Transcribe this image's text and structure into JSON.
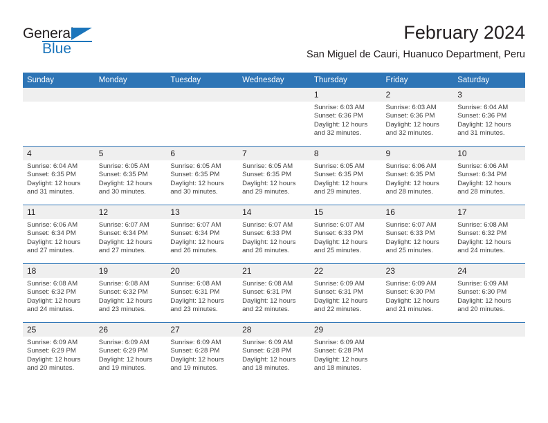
{
  "brand": {
    "name_part1": "General",
    "name_part2": "Blue",
    "triangle_icon": "triangle-icon",
    "colors": {
      "blue": "#1b75bb",
      "black": "#231f20"
    }
  },
  "header": {
    "title": "February 2024",
    "subtitle": "San Miguel de Cauri, Huanuco Department, Peru"
  },
  "theme": {
    "header_blue": "#2e75b6",
    "daynum_band": "#efefef",
    "text": "#404040"
  },
  "weekdays": [
    "Sunday",
    "Monday",
    "Tuesday",
    "Wednesday",
    "Thursday",
    "Friday",
    "Saturday"
  ],
  "weeks": [
    [
      {
        "day": "",
        "empty": true,
        "sunrise": "",
        "sunset": "",
        "daylight1": "",
        "daylight2": ""
      },
      {
        "day": "",
        "empty": true,
        "sunrise": "",
        "sunset": "",
        "daylight1": "",
        "daylight2": ""
      },
      {
        "day": "",
        "empty": true,
        "sunrise": "",
        "sunset": "",
        "daylight1": "",
        "daylight2": ""
      },
      {
        "day": "",
        "empty": true,
        "sunrise": "",
        "sunset": "",
        "daylight1": "",
        "daylight2": ""
      },
      {
        "day": "1",
        "empty": false,
        "sunrise": "Sunrise: 6:03 AM",
        "sunset": "Sunset: 6:36 PM",
        "daylight1": "Daylight: 12 hours",
        "daylight2": "and 32 minutes."
      },
      {
        "day": "2",
        "empty": false,
        "sunrise": "Sunrise: 6:03 AM",
        "sunset": "Sunset: 6:36 PM",
        "daylight1": "Daylight: 12 hours",
        "daylight2": "and 32 minutes."
      },
      {
        "day": "3",
        "empty": false,
        "sunrise": "Sunrise: 6:04 AM",
        "sunset": "Sunset: 6:36 PM",
        "daylight1": "Daylight: 12 hours",
        "daylight2": "and 31 minutes."
      }
    ],
    [
      {
        "day": "4",
        "empty": false,
        "sunrise": "Sunrise: 6:04 AM",
        "sunset": "Sunset: 6:35 PM",
        "daylight1": "Daylight: 12 hours",
        "daylight2": "and 31 minutes."
      },
      {
        "day": "5",
        "empty": false,
        "sunrise": "Sunrise: 6:05 AM",
        "sunset": "Sunset: 6:35 PM",
        "daylight1": "Daylight: 12 hours",
        "daylight2": "and 30 minutes."
      },
      {
        "day": "6",
        "empty": false,
        "sunrise": "Sunrise: 6:05 AM",
        "sunset": "Sunset: 6:35 PM",
        "daylight1": "Daylight: 12 hours",
        "daylight2": "and 30 minutes."
      },
      {
        "day": "7",
        "empty": false,
        "sunrise": "Sunrise: 6:05 AM",
        "sunset": "Sunset: 6:35 PM",
        "daylight1": "Daylight: 12 hours",
        "daylight2": "and 29 minutes."
      },
      {
        "day": "8",
        "empty": false,
        "sunrise": "Sunrise: 6:05 AM",
        "sunset": "Sunset: 6:35 PM",
        "daylight1": "Daylight: 12 hours",
        "daylight2": "and 29 minutes."
      },
      {
        "day": "9",
        "empty": false,
        "sunrise": "Sunrise: 6:06 AM",
        "sunset": "Sunset: 6:35 PM",
        "daylight1": "Daylight: 12 hours",
        "daylight2": "and 28 minutes."
      },
      {
        "day": "10",
        "empty": false,
        "sunrise": "Sunrise: 6:06 AM",
        "sunset": "Sunset: 6:34 PM",
        "daylight1": "Daylight: 12 hours",
        "daylight2": "and 28 minutes."
      }
    ],
    [
      {
        "day": "11",
        "empty": false,
        "sunrise": "Sunrise: 6:06 AM",
        "sunset": "Sunset: 6:34 PM",
        "daylight1": "Daylight: 12 hours",
        "daylight2": "and 27 minutes."
      },
      {
        "day": "12",
        "empty": false,
        "sunrise": "Sunrise: 6:07 AM",
        "sunset": "Sunset: 6:34 PM",
        "daylight1": "Daylight: 12 hours",
        "daylight2": "and 27 minutes."
      },
      {
        "day": "13",
        "empty": false,
        "sunrise": "Sunrise: 6:07 AM",
        "sunset": "Sunset: 6:34 PM",
        "daylight1": "Daylight: 12 hours",
        "daylight2": "and 26 minutes."
      },
      {
        "day": "14",
        "empty": false,
        "sunrise": "Sunrise: 6:07 AM",
        "sunset": "Sunset: 6:33 PM",
        "daylight1": "Daylight: 12 hours",
        "daylight2": "and 26 minutes."
      },
      {
        "day": "15",
        "empty": false,
        "sunrise": "Sunrise: 6:07 AM",
        "sunset": "Sunset: 6:33 PM",
        "daylight1": "Daylight: 12 hours",
        "daylight2": "and 25 minutes."
      },
      {
        "day": "16",
        "empty": false,
        "sunrise": "Sunrise: 6:07 AM",
        "sunset": "Sunset: 6:33 PM",
        "daylight1": "Daylight: 12 hours",
        "daylight2": "and 25 minutes."
      },
      {
        "day": "17",
        "empty": false,
        "sunrise": "Sunrise: 6:08 AM",
        "sunset": "Sunset: 6:32 PM",
        "daylight1": "Daylight: 12 hours",
        "daylight2": "and 24 minutes."
      }
    ],
    [
      {
        "day": "18",
        "empty": false,
        "sunrise": "Sunrise: 6:08 AM",
        "sunset": "Sunset: 6:32 PM",
        "daylight1": "Daylight: 12 hours",
        "daylight2": "and 24 minutes."
      },
      {
        "day": "19",
        "empty": false,
        "sunrise": "Sunrise: 6:08 AM",
        "sunset": "Sunset: 6:32 PM",
        "daylight1": "Daylight: 12 hours",
        "daylight2": "and 23 minutes."
      },
      {
        "day": "20",
        "empty": false,
        "sunrise": "Sunrise: 6:08 AM",
        "sunset": "Sunset: 6:31 PM",
        "daylight1": "Daylight: 12 hours",
        "daylight2": "and 23 minutes."
      },
      {
        "day": "21",
        "empty": false,
        "sunrise": "Sunrise: 6:08 AM",
        "sunset": "Sunset: 6:31 PM",
        "daylight1": "Daylight: 12 hours",
        "daylight2": "and 22 minutes."
      },
      {
        "day": "22",
        "empty": false,
        "sunrise": "Sunrise: 6:09 AM",
        "sunset": "Sunset: 6:31 PM",
        "daylight1": "Daylight: 12 hours",
        "daylight2": "and 22 minutes."
      },
      {
        "day": "23",
        "empty": false,
        "sunrise": "Sunrise: 6:09 AM",
        "sunset": "Sunset: 6:30 PM",
        "daylight1": "Daylight: 12 hours",
        "daylight2": "and 21 minutes."
      },
      {
        "day": "24",
        "empty": false,
        "sunrise": "Sunrise: 6:09 AM",
        "sunset": "Sunset: 6:30 PM",
        "daylight1": "Daylight: 12 hours",
        "daylight2": "and 20 minutes."
      }
    ],
    [
      {
        "day": "25",
        "empty": false,
        "sunrise": "Sunrise: 6:09 AM",
        "sunset": "Sunset: 6:29 PM",
        "daylight1": "Daylight: 12 hours",
        "daylight2": "and 20 minutes."
      },
      {
        "day": "26",
        "empty": false,
        "sunrise": "Sunrise: 6:09 AM",
        "sunset": "Sunset: 6:29 PM",
        "daylight1": "Daylight: 12 hours",
        "daylight2": "and 19 minutes."
      },
      {
        "day": "27",
        "empty": false,
        "sunrise": "Sunrise: 6:09 AM",
        "sunset": "Sunset: 6:28 PM",
        "daylight1": "Daylight: 12 hours",
        "daylight2": "and 19 minutes."
      },
      {
        "day": "28",
        "empty": false,
        "sunrise": "Sunrise: 6:09 AM",
        "sunset": "Sunset: 6:28 PM",
        "daylight1": "Daylight: 12 hours",
        "daylight2": "and 18 minutes."
      },
      {
        "day": "29",
        "empty": false,
        "sunrise": "Sunrise: 6:09 AM",
        "sunset": "Sunset: 6:28 PM",
        "daylight1": "Daylight: 12 hours",
        "daylight2": "and 18 minutes."
      },
      {
        "day": "",
        "empty": true,
        "sunrise": "",
        "sunset": "",
        "daylight1": "",
        "daylight2": ""
      },
      {
        "day": "",
        "empty": true,
        "sunrise": "",
        "sunset": "",
        "daylight1": "",
        "daylight2": ""
      }
    ]
  ]
}
